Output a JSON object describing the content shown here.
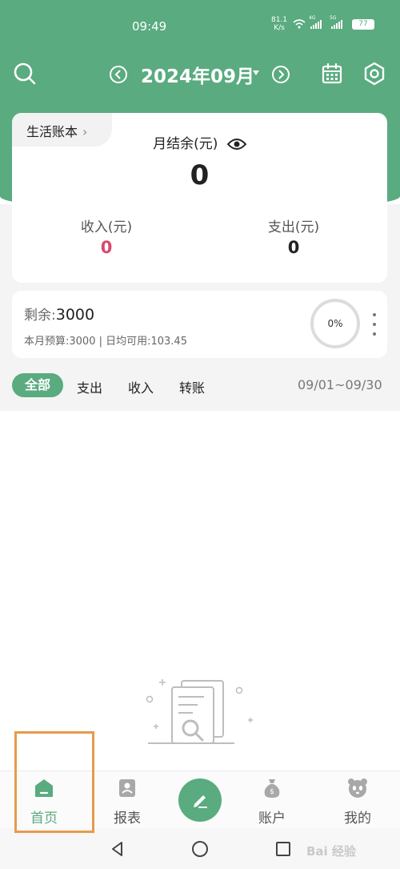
{
  "status": {
    "time": "09:49",
    "net_speed_value": "81.1",
    "net_speed_unit": "K/s",
    "sig1_label": "4G",
    "sig2_label": "5G",
    "battery": "77"
  },
  "header": {
    "month": "2024年09月"
  },
  "summary": {
    "book_name": "生活账本",
    "balance_label": "月结余(元)",
    "balance_value": "0",
    "income_label": "收入(元)",
    "income_value": "0",
    "expense_label": "支出(元)",
    "expense_value": "0"
  },
  "budget": {
    "remain_label": "剩余:",
    "remain_value": "3000",
    "info": "本月预算:3000 | 日均可用:103.45",
    "progress_text": "0%",
    "progress": 0
  },
  "filters": {
    "tabs": [
      "全部",
      "支出",
      "收入",
      "转账"
    ],
    "selected": "全部",
    "date_range": "09/01~09/30"
  },
  "tabbar": {
    "items": [
      {
        "label": "首页",
        "icon": "home-icon"
      },
      {
        "label": "报表",
        "icon": "report-icon"
      },
      {
        "label": "账户",
        "icon": "money-bag-icon"
      },
      {
        "label": "我的",
        "icon": "panda-icon"
      }
    ]
  },
  "watermark": "Bai 经验",
  "colors": {
    "accent": "#5aab80",
    "income": "#d9476b",
    "highlight": "#e89a4b"
  }
}
